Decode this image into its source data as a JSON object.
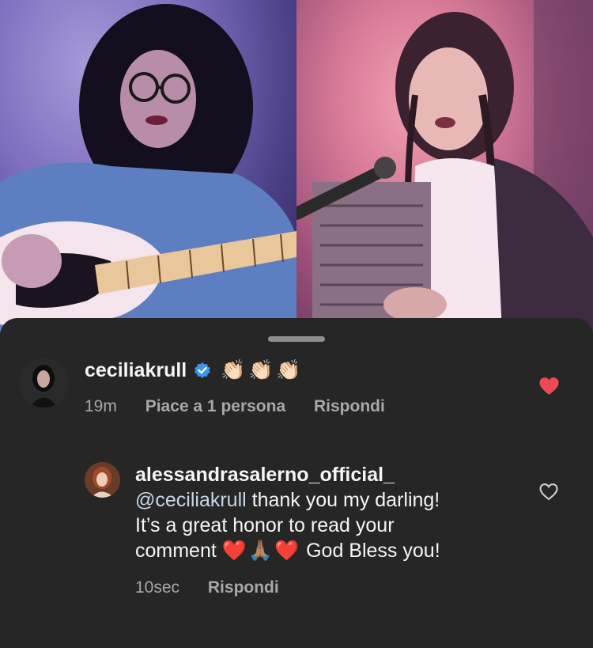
{
  "live": {
    "left_stream": "guitarist-video",
    "right_stream": "singer-video"
  },
  "comments": [
    {
      "username": "ceciliakrull",
      "verified": true,
      "emoji_text": "👏🏻👏🏻👏🏻",
      "time": "19m",
      "likes": "Piace a 1 persona",
      "reply": "Rispondi",
      "liked": true
    },
    {
      "username": "alessandrasalerno_official_",
      "mention": "@ceciliakrull",
      "text_line1": " thank you my darling!",
      "text_line2": "It’s a great honor to read your",
      "text_line3_start": "comment ",
      "text_line3_emojis": "❤️🙏🏽❤️",
      "text_line3_end": " God Bless you!",
      "time": "10sec",
      "reply": "Rispondi",
      "liked": false
    }
  ],
  "colors": {
    "background": "#262626",
    "like_red": "#ed4956",
    "secondary_text": "#a8a8a8"
  }
}
